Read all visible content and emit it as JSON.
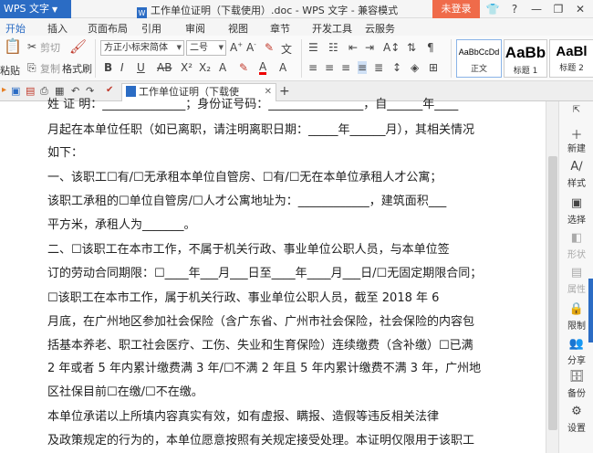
{
  "titlebar": {
    "app_name": "WPS 文字",
    "doc_title": "工作单位证明（下载使用）.doc - WPS 文字 - 兼容模式",
    "login": "未登录"
  },
  "menu": {
    "tabs": [
      "开始",
      "插入",
      "页面布局",
      "引用",
      "审阅",
      "视图",
      "章节",
      "开发工具",
      "云服务"
    ]
  },
  "ribbon": {
    "paste": "粘贴",
    "cut": "剪切",
    "copy": "复制",
    "format_painter": "格式刷",
    "font_name": "方正小标宋简体",
    "font_size": "二号",
    "styles": [
      {
        "preview": "AaBbCcDd",
        "label": "正文"
      },
      {
        "preview": "AaBb",
        "label": "标题 1"
      },
      {
        "preview": "AaBl",
        "label": "标题 2"
      }
    ]
  },
  "doc_tab": {
    "label": "工作单位证明（下载使用）.doc"
  },
  "document": {
    "lines": [
      "  姓  证 明：______________；身份证号码：________________，自______年____",
      "月起在本单位任职（如已离职，请注明离职日期：_____年______月），其相关情况",
      "如下：",
      "    一、该职工☐有/☐无承租本单位自管房、☐有/☐无在本单位承租人才公寓；",
      "    该职工承租的☐单位自管房/☐人才公寓地址为：____________，建筑面积___",
      "平方米，承租人为_______。",
      "    二、☐该职工在本市工作，不属于机关行政、事业单位公职人员，与本单位签",
      "订的劳动合同期限：☐____年___月___日至____年____月___日/☐无固定期限合同；",
      "    ☐该职工在本市工作，属于机关行政、事业单位公职人员，截至 2018 年 6",
      "月底，在广州地区参加社会保险（含广东省、广州市社会保险，社会保险的内容包",
      "括基本养老、职工社会医疗、工伤、失业和生育保险）连续缴费（含补缴）☐已满",
      "2 年或者 5 年内累计缴费满 3 年/☐不满 2 年且 5 年内累计缴费不满 3 年，广州地",
      "区社保目前☐在缴/☐不在缴。",
      "    本单位承诺以上所填内容真实有效，如有虚报、瞒报、造假等违反相关法律",
      "及政策规定的行为的，本单位愿意按照有关规定接受处理。本证明仅限用于该职工"
    ]
  },
  "right_panel": {
    "items": [
      {
        "label": "新建",
        "icon": "plus-icon"
      },
      {
        "label": "样式",
        "icon": "style-icon"
      },
      {
        "label": "选择",
        "icon": "select-icon"
      },
      {
        "label": "形状",
        "icon": "shape-icon"
      },
      {
        "label": "属性",
        "icon": "properties-icon"
      },
      {
        "label": "限制",
        "icon": "lock-icon"
      },
      {
        "label": "分享",
        "icon": "share-icon"
      },
      {
        "label": "备份",
        "icon": "backup-icon"
      },
      {
        "label": "设置",
        "icon": "gear-icon"
      }
    ]
  }
}
